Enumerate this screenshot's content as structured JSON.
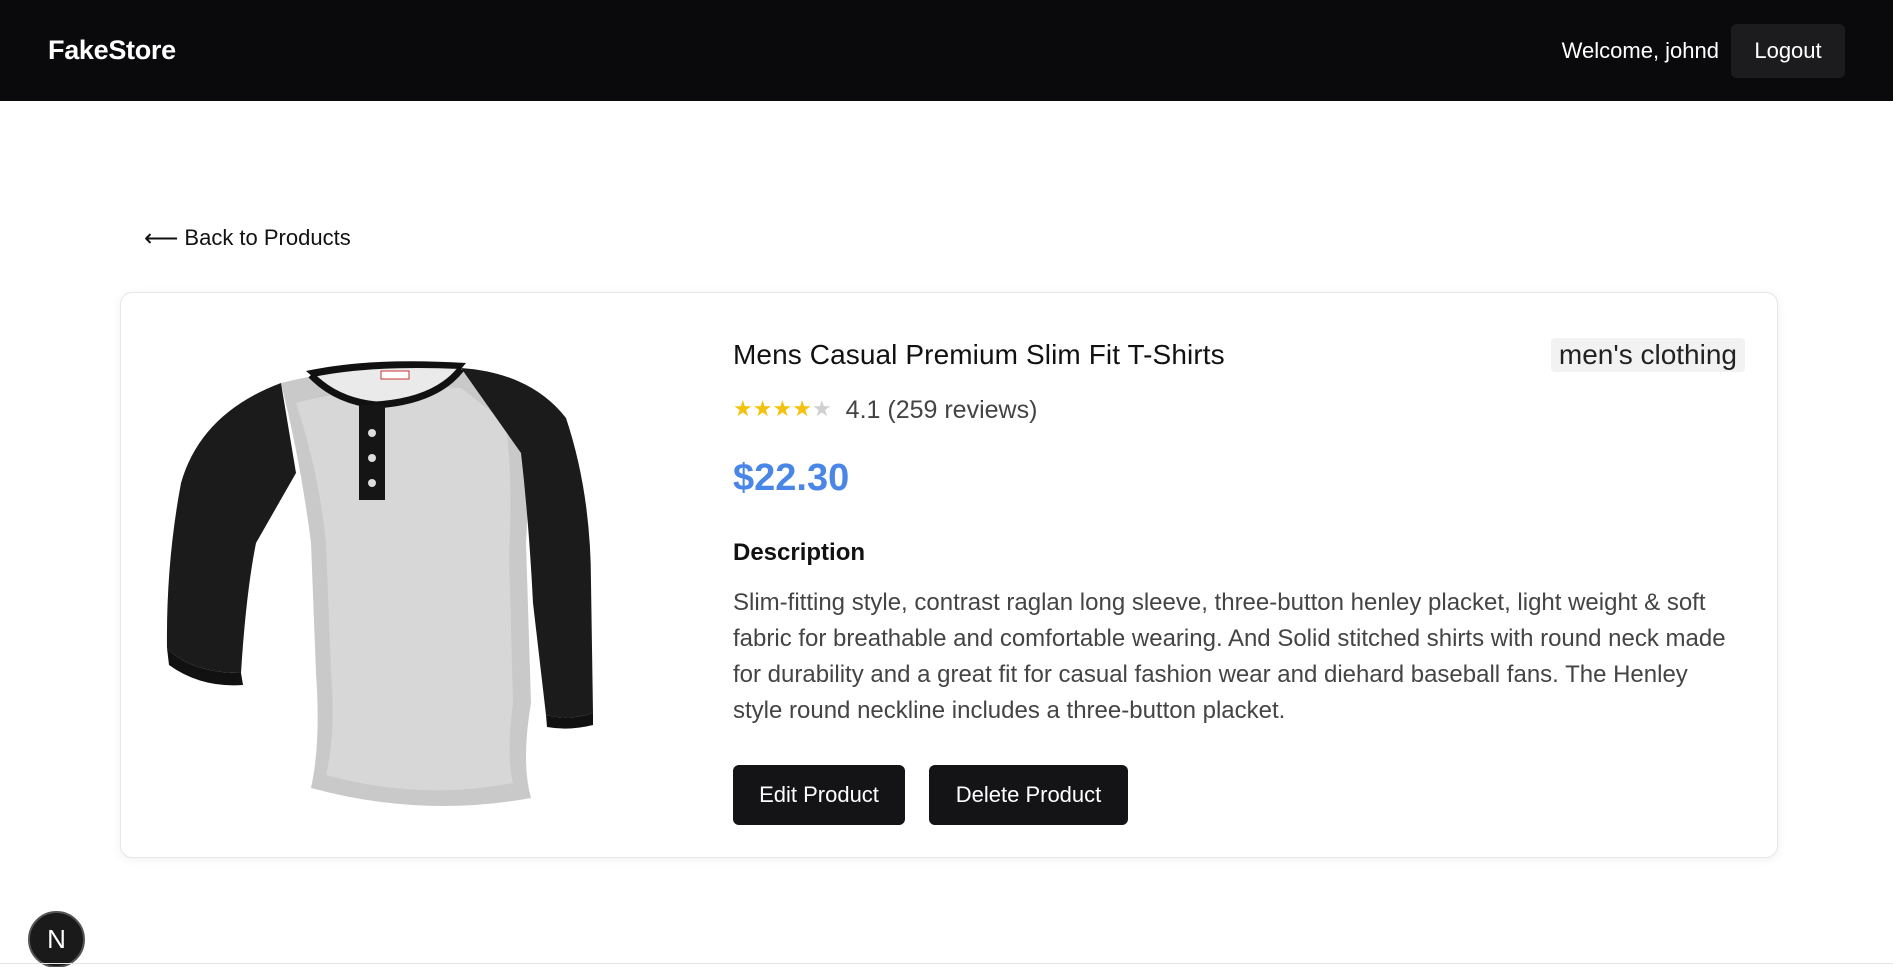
{
  "header": {
    "brand": "FakeStore",
    "welcome": "Welcome, johnd",
    "logout_label": "Logout"
  },
  "nav": {
    "back_label": "Back to Products"
  },
  "product": {
    "title": "Mens Casual Premium Slim Fit T-Shirts",
    "category": "men's clothing",
    "rating_value": 4.1,
    "rating_text": "4.1 (259 reviews)",
    "price": "$22.30",
    "description_heading": "Description",
    "description": "Slim-fitting style, contrast raglan long sleeve, three-button henley placket, light weight & soft fabric for breathable and comfortable wearing. And Solid stitched shirts with round neck made for durability and a great fit for casual fashion wear and diehard baseball fans. The Henley style round neckline includes a three-button placket.",
    "edit_label": "Edit Product",
    "delete_label": "Delete Product"
  },
  "dev_badge": {
    "letter": "N"
  },
  "colors": {
    "header_bg": "#0a0a0c",
    "price": "#4a86e8",
    "star": "#f4c20d",
    "button_bg": "#141416"
  },
  "icons": {
    "back": "arrow-left-icon",
    "star": "star-icon",
    "product_image": "henley-shirt-image"
  }
}
